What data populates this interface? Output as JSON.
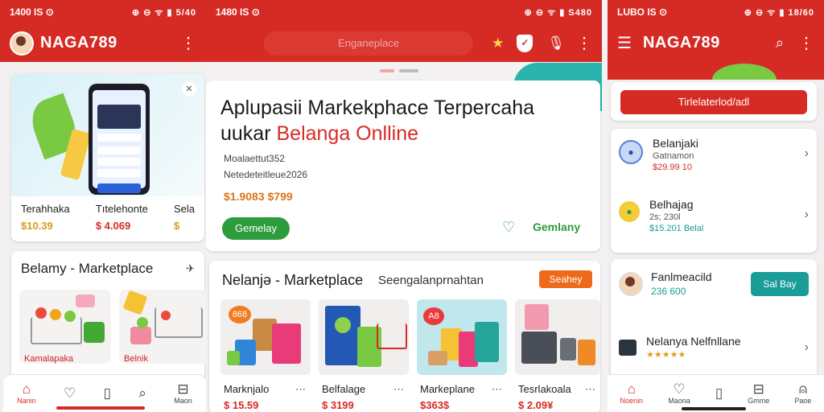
{
  "colors": {
    "brand": "#d62b25",
    "green": "#2e9b3c",
    "teal": "#1a9c98",
    "orange": "#ee6a1b",
    "gold": "#d99a1a"
  },
  "left": {
    "status": {
      "time": "1400 IS ⊙",
      "right": "⊕ ⊖ ᯤ ▮ 5/40"
    },
    "app_title": "NAGA789",
    "cards": [
      {
        "name": "Terahhaka",
        "price": "$10.39"
      },
      {
        "name": "Tıtelehonte",
        "price": "$ 4.069"
      },
      {
        "name": "Sela",
        "price": "$"
      }
    ],
    "section_title": "Belamy - Marketplace",
    "thumbs": [
      {
        "label": "Kamalapaka"
      },
      {
        "label": "Belnik"
      }
    ],
    "nav": [
      {
        "icon": "home-icon",
        "glyph": "⌂",
        "label": "Nanin"
      },
      {
        "icon": "heart-icon",
        "glyph": "♡",
        "label": ""
      },
      {
        "icon": "book-icon",
        "glyph": "▯",
        "label": ""
      },
      {
        "icon": "search-icon",
        "glyph": "⌕",
        "label": ""
      },
      {
        "icon": "inbox-icon",
        "glyph": "⊟",
        "label": "Maon"
      }
    ]
  },
  "middle": {
    "status": {
      "time": "1480 IS ⊙",
      "right": "⊕ ⊖ ᯤ ▮ S480"
    },
    "search_placeholder": "Enganeplace",
    "hero": {
      "title_line1": "Aplupasii Markekphace Terpercaha",
      "title_line2_pre": "uukar ",
      "title_line2_red": "Belanga Onlline",
      "meta1": "Moalaettut352",
      "meta2": "Netedeteitleue2026",
      "price": "$1.9083 $799",
      "primary_button": "Gemelay",
      "secondary_label": "Gemlany"
    },
    "section": {
      "title": "Nelanjə - Marketplace",
      "subtitle": "Seengalanprnahtan",
      "action": "Seahey"
    },
    "products": [
      {
        "badge": "868",
        "name": "Marknjalo",
        "price": "$ 15.59"
      },
      {
        "badge": "",
        "name": "Belfalage",
        "price": "$ 3199"
      },
      {
        "badge": "A8",
        "name": "Markeplane",
        "price": "$363$"
      },
      {
        "badge": "",
        "name": "Tesrlakoala",
        "price": "$ 2.09¥"
      }
    ]
  },
  "right": {
    "status": {
      "time": "LUBO IS ⊙",
      "right": "⊕ ⊖ ᯤ ▮ 18/60"
    },
    "app_title": "NAGA789",
    "cta": "Tirlelaterlod/adl",
    "list1": [
      {
        "title": "Belanjaki",
        "sub": "Gatnamon",
        "price": "$29.99 10"
      },
      {
        "title": "Belhajag",
        "sub": "2s; 230l",
        "price": "$15.201 Belal"
      }
    ],
    "seller": {
      "name": "Fanlmeacild",
      "num": "236 600",
      "button": "Sal Bay"
    },
    "item": {
      "name": "Nelanya Nelfnllane",
      "stars": "★★★★★"
    },
    "nav": [
      {
        "icon": "home-icon",
        "glyph": "⌂",
        "label": "Noenin"
      },
      {
        "icon": "heart-icon",
        "glyph": "♡",
        "label": "Maona"
      },
      {
        "icon": "book-icon",
        "glyph": "▯",
        "label": ""
      },
      {
        "icon": "inbox-icon",
        "glyph": "⊟",
        "label": "Gmme"
      },
      {
        "icon": "user-icon",
        "glyph": "⍝",
        "label": "Paoe"
      }
    ]
  }
}
